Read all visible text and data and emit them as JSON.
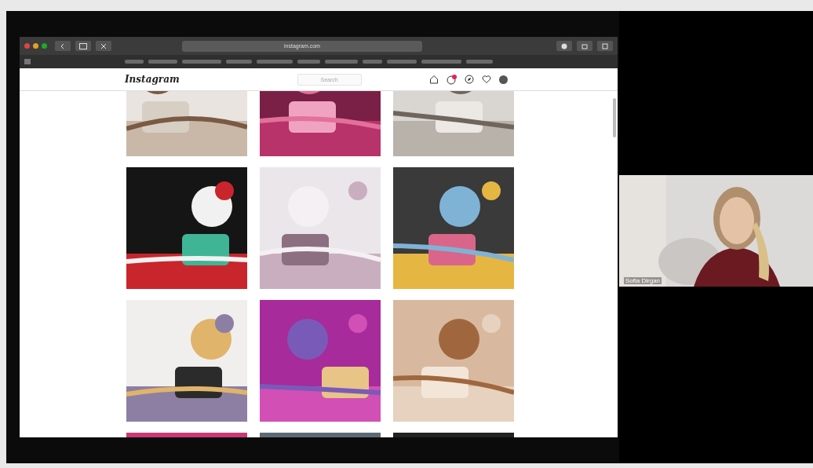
{
  "browser": {
    "address": "instagram.com",
    "bookmarks": [
      {
        "kind": "bar"
      },
      {
        "kind": "bar"
      },
      {
        "kind": "bar"
      },
      {
        "kind": "bar"
      },
      {
        "kind": "bar"
      },
      {
        "kind": "bar"
      },
      {
        "kind": "bar"
      },
      {
        "kind": "bar"
      },
      {
        "kind": "bar"
      },
      {
        "kind": "bar"
      },
      {
        "kind": "bar"
      }
    ],
    "page": {
      "logo": "Instagram",
      "search": {
        "placeholder": "Search"
      }
    }
  },
  "participant": {
    "name": "Sofia Dirgan"
  }
}
